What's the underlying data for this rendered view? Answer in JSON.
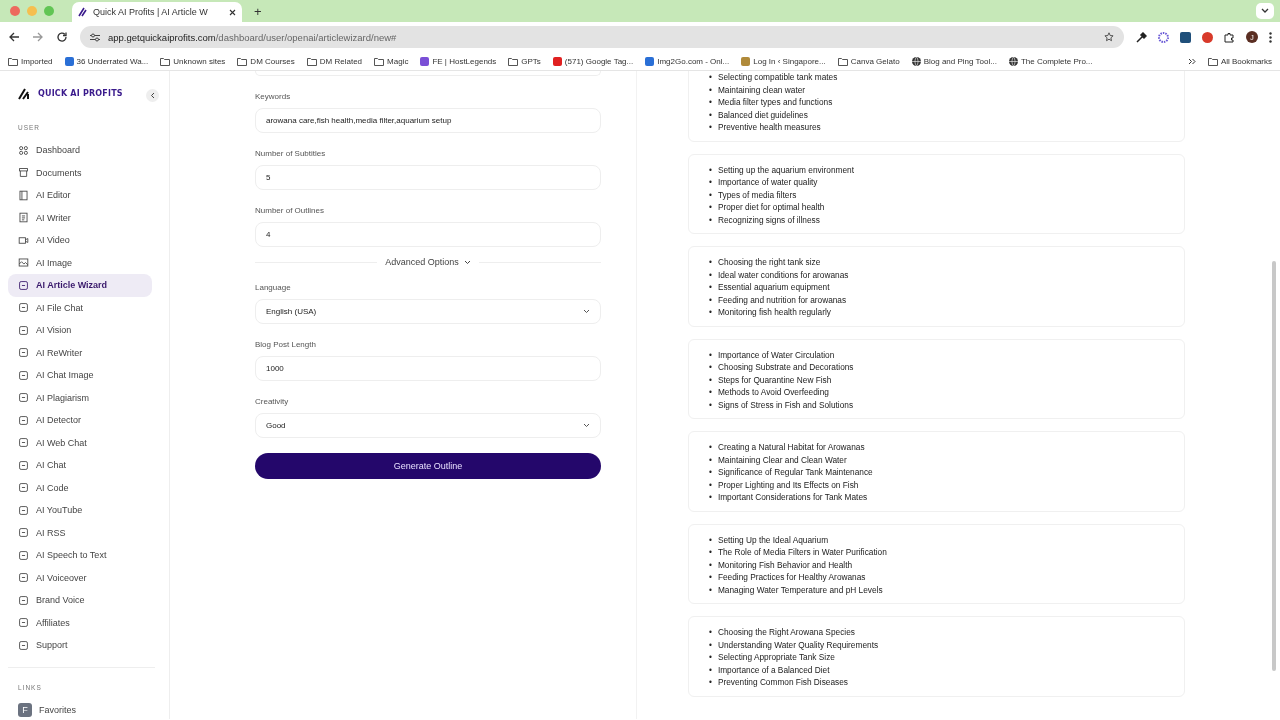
{
  "browser": {
    "tab": {
      "title": "Quick AI Profits | AI Article W",
      "selected": true
    },
    "new_tab": "+",
    "url": {
      "domain": "app.getquickaiprofits.com",
      "path": "/dashboard/user/openai/articlewizard/new#"
    },
    "profile": "J",
    "bookmarks": [
      {
        "kind": "folder",
        "label": "Imported"
      },
      {
        "kind": "site",
        "label": "36 Underrated Wa...",
        "color": "#2a6fd6"
      },
      {
        "kind": "folder",
        "label": "Unknown sites"
      },
      {
        "kind": "folder",
        "label": "DM Courses"
      },
      {
        "kind": "folder",
        "label": "DM Related"
      },
      {
        "kind": "folder",
        "label": "Magic"
      },
      {
        "kind": "site",
        "label": "FE | HostLegends",
        "color": "#7a4fd6"
      },
      {
        "kind": "folder",
        "label": "GPTs"
      },
      {
        "kind": "site",
        "label": "(571) Google Tag...",
        "color": "#e02020"
      },
      {
        "kind": "site",
        "label": "Img2Go.com - Onl...",
        "color": "#2a6fd6"
      },
      {
        "kind": "site",
        "label": "Log In ‹ Singapore...",
        "color": "#b08a3a"
      },
      {
        "kind": "folder",
        "label": "Canva Gelato"
      },
      {
        "kind": "globe",
        "label": "Blog and Ping Tool..."
      },
      {
        "kind": "globe",
        "label": "The Complete Pro..."
      }
    ],
    "all_bookmarks": "All Bookmarks"
  },
  "sidebar": {
    "logo": "QUICK AI PROFITS",
    "section": "USER",
    "items": [
      {
        "label": "Dashboard",
        "selected": false
      },
      {
        "label": "Documents",
        "selected": false
      },
      {
        "label": "AI Editor",
        "selected": false
      },
      {
        "label": "AI Writer",
        "selected": false
      },
      {
        "label": "AI Video",
        "selected": false
      },
      {
        "label": "AI Image",
        "selected": false
      },
      {
        "label": "AI Article Wizard",
        "selected": true
      },
      {
        "label": "AI File Chat",
        "selected": false
      },
      {
        "label": "AI Vision",
        "selected": false
      },
      {
        "label": "AI ReWriter",
        "selected": false
      },
      {
        "label": "AI Chat Image",
        "selected": false
      },
      {
        "label": "AI Plagiarism",
        "selected": false
      },
      {
        "label": "AI Detector",
        "selected": false
      },
      {
        "label": "AI Web Chat",
        "selected": false
      },
      {
        "label": "AI Chat",
        "selected": false
      },
      {
        "label": "AI Code",
        "selected": false
      },
      {
        "label": "AI YouTube",
        "selected": false
      },
      {
        "label": "AI RSS",
        "selected": false
      },
      {
        "label": "AI Speech to Text",
        "selected": false
      },
      {
        "label": "AI Voiceover",
        "selected": false
      },
      {
        "label": "Brand Voice",
        "selected": false
      },
      {
        "label": "Affiliates",
        "selected": false
      },
      {
        "label": "Support",
        "selected": false
      }
    ],
    "links_section": "LINKS",
    "links": [
      {
        "badge": "F",
        "label": "Favorites"
      }
    ]
  },
  "form": {
    "fields": [
      {
        "kind": "input",
        "label": "Keywords",
        "value": "arowana care,fish health,media filter,aquarium setup"
      },
      {
        "kind": "input",
        "label": "Number of Subtitles",
        "value": "5"
      },
      {
        "kind": "input",
        "label": "Number of Outlines",
        "value": "4"
      },
      {
        "kind": "divider",
        "label": "Advanced Options"
      },
      {
        "kind": "select",
        "label": "Language",
        "value": "English (USA)"
      },
      {
        "kind": "input",
        "label": "Blog Post Length",
        "value": "1000"
      },
      {
        "kind": "select",
        "label": "Creativity",
        "value": "Good"
      }
    ],
    "button": "Generate Outline"
  },
  "bullet": "•",
  "outlines": [
    [
      "Selecting compatible tank mates",
      "Maintaining clean water",
      "Media filter types and functions",
      "Balanced diet guidelines",
      "Preventive health measures"
    ],
    [
      "Setting up the aquarium environment",
      "Importance of water quality",
      "Types of media filters",
      "Proper diet for optimal health",
      "Recognizing signs of illness"
    ],
    [
      "Choosing the right tank size",
      "Ideal water conditions for arowanas",
      "Essential aquarium equipment",
      "Feeding and nutrition for arowanas",
      "Monitoring fish health regularly"
    ],
    [
      "Importance of Water Circulation",
      "Choosing Substrate and Decorations",
      "Steps for Quarantine New Fish",
      "Methods to Avoid Overfeeding",
      "Signs of Stress in Fish and Solutions"
    ],
    [
      "Creating a Natural Habitat for Arowanas",
      "Maintaining Clear and Clean Water",
      "Significance of Regular Tank Maintenance",
      "Proper Lighting and Its Effects on Fish",
      "Important Considerations for Tank Mates"
    ],
    [
      "Setting Up the Ideal Aquarium",
      "The Role of Media Filters in Water Purification",
      "Monitoring Fish Behavior and Health",
      "Feeding Practices for Healthy Arowanas",
      "Managing Water Temperature and pH Levels"
    ],
    [
      "Choosing the Right Arowana Species",
      "Understanding Water Quality Requirements",
      "Selecting Appropriate Tank Size",
      "Importance of a Balanced Diet",
      "Preventing Common Fish Diseases"
    ]
  ]
}
